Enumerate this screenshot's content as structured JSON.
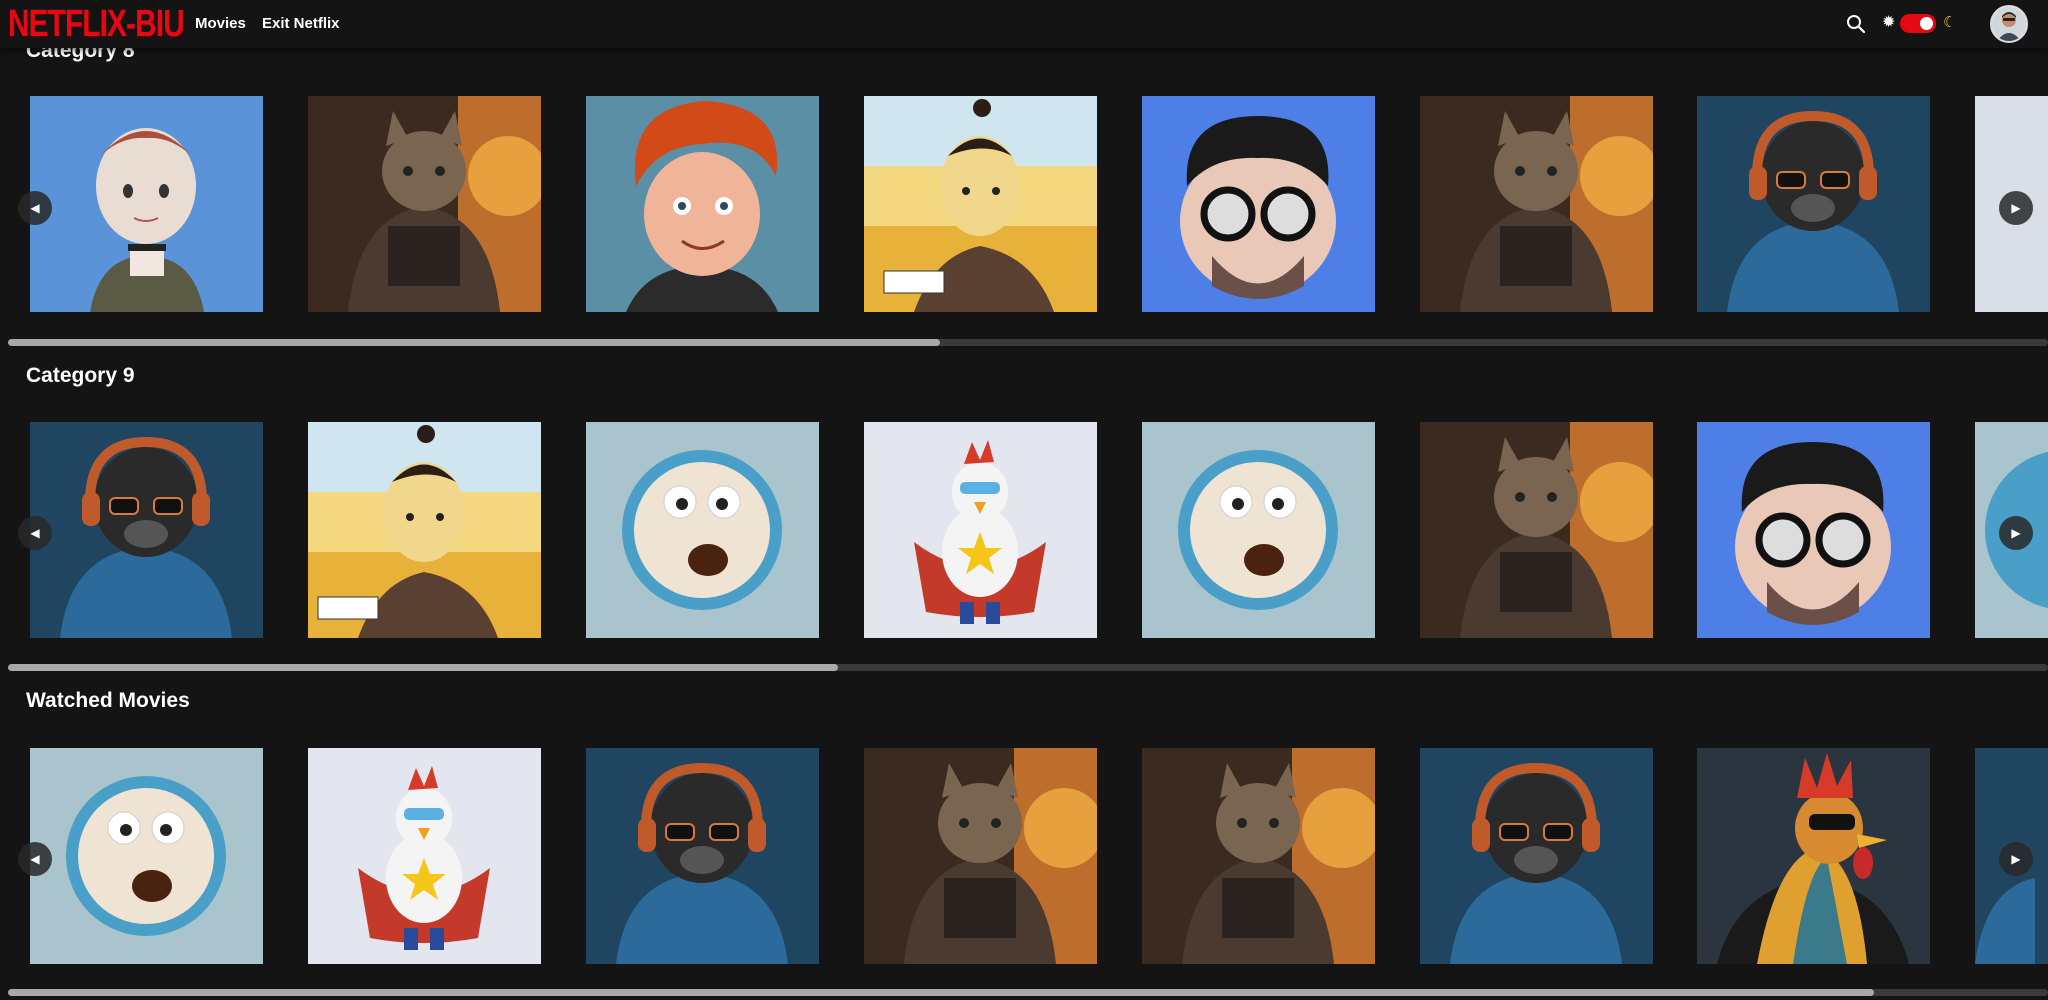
{
  "nav": {
    "logo": "NETFLIX-BIU",
    "links": [
      "Movies",
      "Exit Netflix"
    ]
  },
  "colors": {
    "brand_red": "#e50914",
    "background": "#141414",
    "toggle_on": "#e50914"
  },
  "icons": {
    "search": "search-icon",
    "sun": "sun-icon",
    "moon": "moon-icon"
  },
  "theme_toggle": {
    "dark_mode": true
  },
  "rows": [
    {
      "title": "Category 8",
      "items": [
        "boy-avatar",
        "cat-armor",
        "red-hair-boy",
        "topknot-boy",
        "glasses-man",
        "cat-armor",
        "monkey-headphones",
        "partial-card"
      ],
      "scroll_fraction": 0.35
    },
    {
      "title": "Category 9",
      "items": [
        "monkey-headphones",
        "topknot-boy",
        "coffee-cup",
        "superhero-chicken",
        "coffee-cup",
        "cat-armor",
        "glasses-man",
        "partial-card"
      ],
      "scroll_fraction": 0.31
    },
    {
      "title": "Watched Movies",
      "items": [
        "coffee-cup",
        "superhero-chicken",
        "monkey-headphones",
        "cat-armor",
        "cat-armor",
        "monkey-headphones",
        "rooster-leather",
        "partial-card"
      ],
      "scroll_fraction": 0.7
    }
  ],
  "arrows": {
    "left": "◀",
    "right": "▶"
  }
}
